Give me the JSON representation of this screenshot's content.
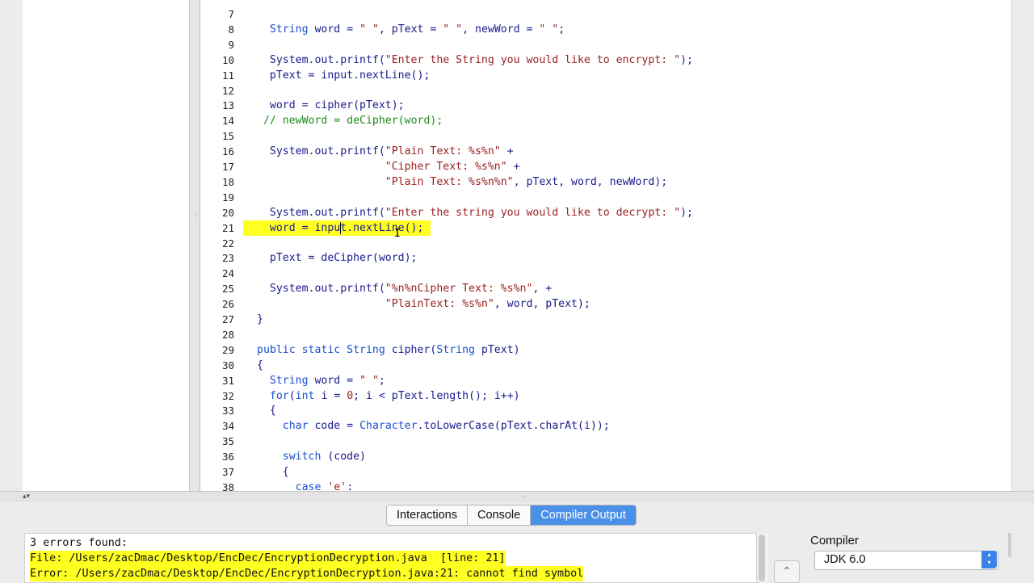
{
  "editor": {
    "lines": [
      {
        "n": "7",
        "code": ""
      },
      {
        "n": "8",
        "code": "  <span class=\"kw\">String</span> word = <span class=\"str\">\" \"</span>, pText = <span class=\"str\">\" \"</span>, newWord = <span class=\"str\">\" \"</span>;"
      },
      {
        "n": "9",
        "code": ""
      },
      {
        "n": "10",
        "code": "  System.out.printf(<span class=\"str\">\"Enter the String you would like to encrypt: \"</span>);"
      },
      {
        "n": "11",
        "code": "  pText = input.nextLine();"
      },
      {
        "n": "12",
        "code": ""
      },
      {
        "n": "13",
        "code": "  word = cipher(pText);"
      },
      {
        "n": "14",
        "code": " <span class=\"cm\">// newWord = deCipher(word);</span>"
      },
      {
        "n": "15",
        "code": ""
      },
      {
        "n": "16",
        "code": "  System.out.printf(<span class=\"str\">\"Plain Text: %s%n\"</span> +"
      },
      {
        "n": "17",
        "code": "                    <span class=\"str\">\"Cipher Text: %s%n\"</span> +"
      },
      {
        "n": "18",
        "code": "                    <span class=\"str\">\"Plain Text: %s%n%n\"</span>, pText, word, newWord);"
      },
      {
        "n": "19",
        "code": ""
      },
      {
        "n": "20",
        "code": "  System.out.printf(<span class=\"str\">\"Enter the string you would like to decrypt: \"</span>);"
      },
      {
        "n": "21",
        "code": "  word = input.nextLine();",
        "highlight": true
      },
      {
        "n": "22",
        "code": ""
      },
      {
        "n": "23",
        "code": "  pText = deCipher(word);"
      },
      {
        "n": "24",
        "code": ""
      },
      {
        "n": "25",
        "code": "  System.out.printf(<span class=\"str\">\"%n%nCipher Text: %s%n\"</span>, +"
      },
      {
        "n": "26",
        "code": "                    <span class=\"str\">\"PlainText: %s%n\"</span>, word, pText);"
      },
      {
        "n": "27",
        "code": "}"
      },
      {
        "n": "28",
        "code": ""
      },
      {
        "n": "29",
        "code": "<span class=\"kw\">public static String</span> cipher(<span class=\"kw\">String</span> pText)"
      },
      {
        "n": "30",
        "code": "{"
      },
      {
        "n": "31",
        "code": "  <span class=\"kw\">String</span> word = <span class=\"str\">\" \"</span>;"
      },
      {
        "n": "32",
        "code": "  <span class=\"kw\">for</span>(<span class=\"kw\">int</span> i = <span class=\"num\">0</span>; i &lt; pText.length(); i++)"
      },
      {
        "n": "33",
        "code": "  {"
      },
      {
        "n": "34",
        "code": "    <span class=\"kw\">char</span> code = <span class=\"kw\">Character</span>.toLowerCase(pText.charAt(i));"
      },
      {
        "n": "35",
        "code": ""
      },
      {
        "n": "36",
        "code": "    <span class=\"kw\">switch</span> (code)"
      },
      {
        "n": "37",
        "code": "    {"
      },
      {
        "n": "38",
        "code": "      <span class=\"kw\">case</span> <span class=\"str\">'e'</span>:"
      }
    ]
  },
  "tabs": [
    {
      "label": "Interactions",
      "active": false
    },
    {
      "label": "Console",
      "active": false
    },
    {
      "label": "Compiler Output",
      "active": true
    }
  ],
  "output": {
    "lines": [
      {
        "text": "3 errors found:",
        "highlight": false
      },
      {
        "text": "File: /Users/zacDmac/Desktop/EncDec/EncryptionDecryption.java  [line: 21]",
        "highlight": true
      },
      {
        "text": "Error: /Users/zacDmac/Desktop/EncDec/EncryptionDecryption.java:21: cannot find symbol",
        "highlight": true
      }
    ]
  },
  "compiler": {
    "label": "Compiler",
    "selected": "JDK 6.0"
  },
  "colors": {
    "highlight": "#ffff22",
    "active_tab": "#4a90e8",
    "keyword": "#1a4fd0",
    "string": "#9a2020",
    "comment": "#1b8c1b"
  }
}
